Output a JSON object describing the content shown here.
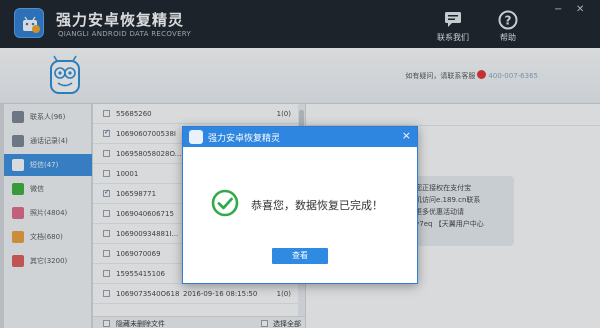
{
  "app": {
    "title": "强力安卓恢复精灵",
    "subtitle": "QIANGLI ANDROID DATA RECOVERY"
  },
  "window_controls": {
    "minimize": "−",
    "close": "✕"
  },
  "header_buttons": {
    "contact": {
      "label": "联系我们",
      "icon": "chat-icon"
    },
    "help": {
      "label": "帮助",
      "icon": "help-icon"
    }
  },
  "info_strip": {
    "contact_prefix": "如有疑问，请联系客服",
    "phone": "400-007-6365"
  },
  "sidebar": {
    "items": [
      {
        "label": "联系人(96)",
        "icon": "contacts-icon",
        "color": "#7d8794"
      },
      {
        "label": "通话记录(4)",
        "icon": "call-log-icon",
        "color": "#7d8794"
      },
      {
        "label": "短信(47)",
        "icon": "sms-icon",
        "color": "#ffffff",
        "active": true
      },
      {
        "label": "微信",
        "icon": "wechat-icon",
        "color": "#3bb33a"
      },
      {
        "label": "照片(4804)",
        "icon": "photos-icon",
        "color": "#e46b8a"
      },
      {
        "label": "文档(680)",
        "icon": "documents-icon",
        "color": "#f0a23a"
      },
      {
        "label": "其它(3200)",
        "icon": "other-icon",
        "color": "#e25c5c"
      }
    ]
  },
  "message_list": {
    "rows": [
      {
        "number": "55685260",
        "date": "",
        "count": "1(0)",
        "checked": false
      },
      {
        "number": "1069060700538I",
        "date": "",
        "count": "",
        "checked": true
      },
      {
        "number": "106958058028O...",
        "date": "",
        "count": "",
        "checked": false
      },
      {
        "number": "10001",
        "date": "",
        "count": "",
        "checked": false
      },
      {
        "number": "106598771",
        "date": "",
        "count": "",
        "checked": true
      },
      {
        "number": "1069040606715",
        "date": "",
        "count": "",
        "checked": false
      },
      {
        "number": "106900934881I...",
        "date": "",
        "count": "",
        "checked": false
      },
      {
        "number": "1069070069",
        "date": "",
        "count": "",
        "checked": false
      },
      {
        "number": "15955415106",
        "date": "",
        "count": "",
        "checked": false
      },
      {
        "number": "1069073540O618",
        "date": "2016-09-16 08:15:50",
        "count": "1(0)",
        "checked": false
      }
    ],
    "footer": {
      "hide_deleted": "隐藏未删除文件",
      "select_all": "选择全部"
    }
  },
  "detail": {
    "bubble_lines": [
      "), 您正接权在支付宝",
      "手机访问e.189.cn联系",
      "享更多优惠活动请",
      "",
      "Vfy7eq 【天翼用户中心"
    ]
  },
  "dialog": {
    "title": "强力安卓恢复精灵",
    "close": "×",
    "message": "恭喜您，数据恢复已完成！",
    "ok_label": "查看",
    "accent": "#2f86e0",
    "success_color": "#34a94a"
  }
}
